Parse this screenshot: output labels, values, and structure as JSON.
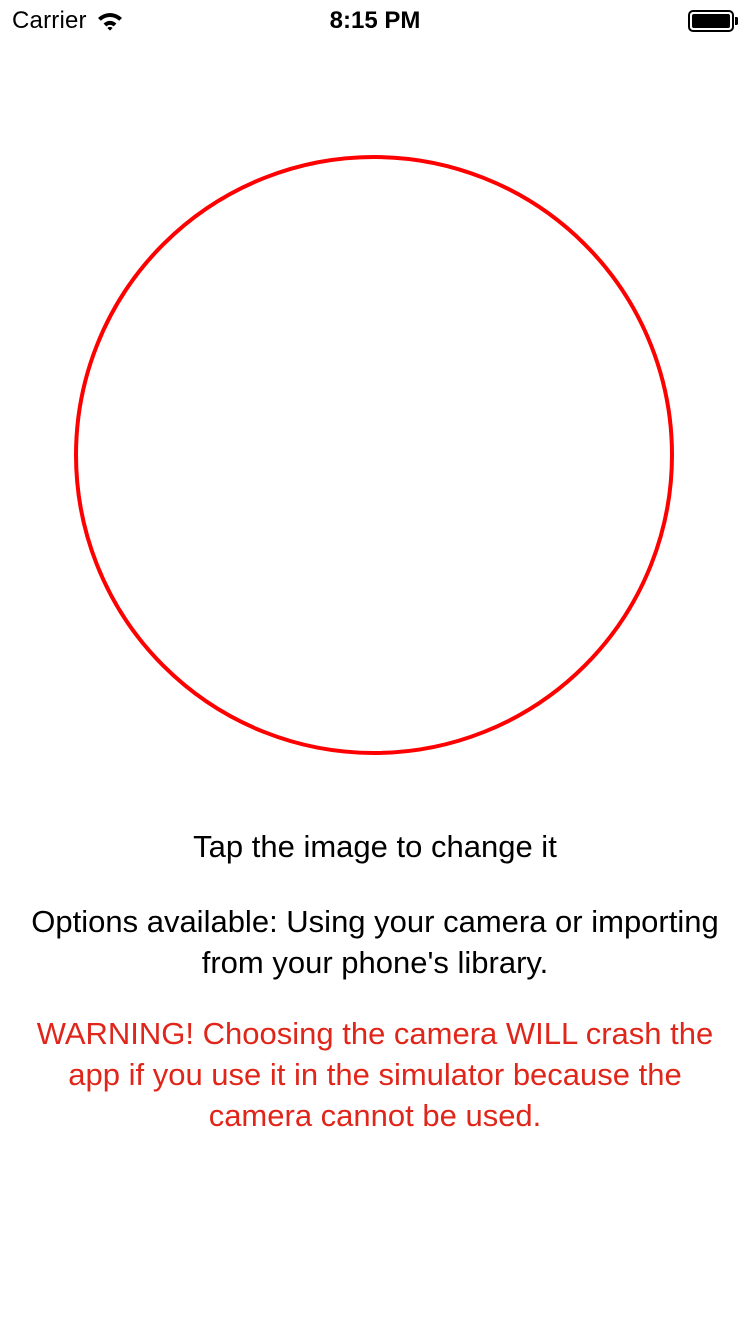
{
  "status_bar": {
    "carrier": "Carrier",
    "time": "8:15 PM",
    "icons": [
      "wifi-icon",
      "battery-icon"
    ]
  },
  "main": {
    "image_placeholder": {
      "border_color": "#ff0000"
    },
    "tap_instruction": "Tap the image to change it",
    "options_text": "Options available: Using your camera or importing from your phone's library.",
    "warning_text": "WARNING! Choosing the camera WILL crash the app if you use it in the simulator because the camera cannot be used."
  },
  "colors": {
    "circle_border": "#ff0000",
    "warning_text": "#e0261b",
    "body_text": "#000000",
    "background": "#ffffff"
  }
}
